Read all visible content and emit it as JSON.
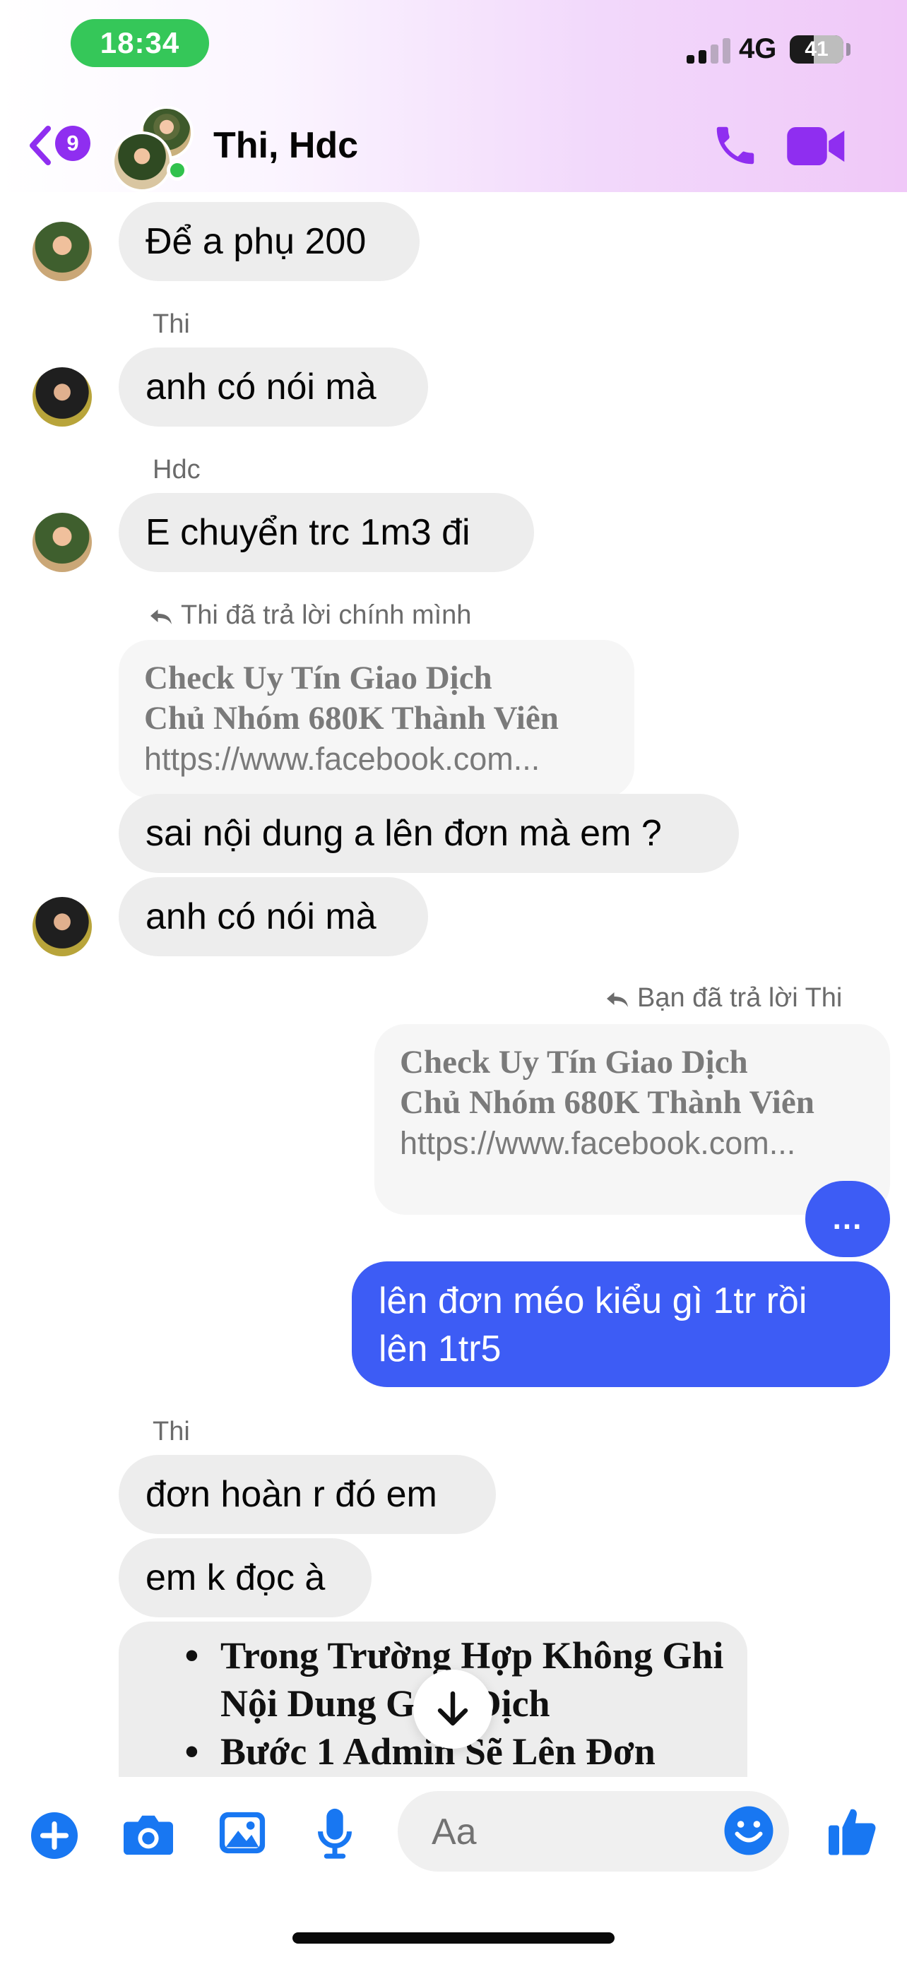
{
  "status_bar": {
    "time": "18:34",
    "network": "4G",
    "battery": "41"
  },
  "header": {
    "back_badge": "9",
    "title": "Thi, Hdc"
  },
  "messages": {
    "m1": "Để a phụ 200",
    "sender_thi": "Thi",
    "m2": "anh có nói mà",
    "sender_hdc": "Hdc",
    "m3": "E chuyển trc 1m3 đi",
    "reply_note_1": "Thi đã trả lời chính mình",
    "quote_title_1": "Check Uy Tín Giao Dịch",
    "quote_line2_1": "Chủ Nhóm 680K Thành Viên",
    "quote_link_1": "https://www.facebook.com...",
    "m4": "sai nội dung a lên đơn mà em ?",
    "m5": "anh có nói mà",
    "reply_note_2": "Bạn đã trả lời Thi",
    "quote_title_2": "Check Uy Tín Giao Dịch",
    "quote_line2_2": "Chủ Nhóm 680K Thành Viên",
    "quote_link_2": "https://www.facebook.com...",
    "mine_dots": "...",
    "mine_text": "lên đơn méo kiểu gì 1tr rồi lên 1tr5",
    "sender_thi_2": "Thi",
    "m6": "đơn hoàn r đó em",
    "m7": "em k đọc à",
    "list_items": [
      "Trong Trường Hợp Không Ghi Nội Dung Giao Dịch",
      "Bước 1 Admin Sẽ Lên Đơn"
    ]
  },
  "composer": {
    "placeholder": "Aa"
  },
  "colors": {
    "accent": "#8f2ef0",
    "my_bubble": "#3d5cf5",
    "composer_icons": "#1877f2"
  }
}
